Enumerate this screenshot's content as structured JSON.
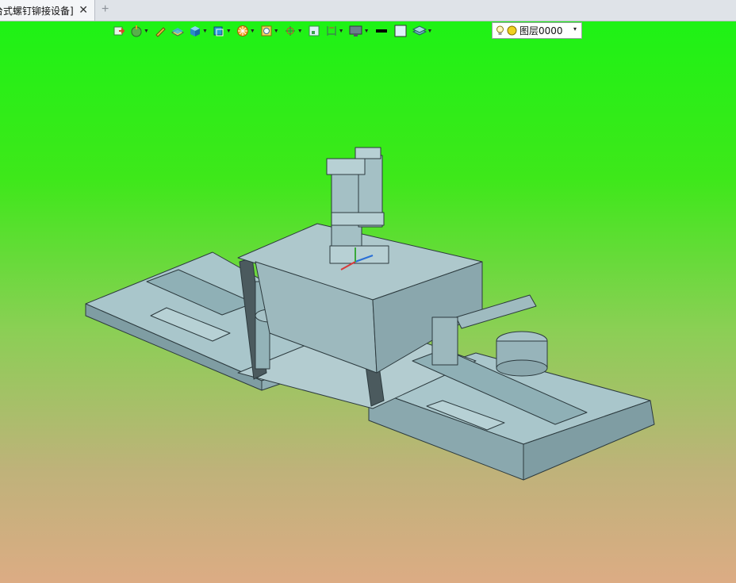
{
  "tab": {
    "title": "台式螺钉铆接设备]",
    "close": "✕",
    "add": "+"
  },
  "toolbar": {
    "buttons": [
      {
        "name": "import-icon"
      },
      {
        "name": "globe-icon"
      },
      {
        "name": "pencil-icon"
      },
      {
        "name": "surface-icon"
      },
      {
        "name": "solid-box-icon"
      },
      {
        "name": "view-cube-icon"
      },
      {
        "name": "render-icon"
      },
      {
        "name": "zoom-icon"
      },
      {
        "name": "axis-icon"
      },
      {
        "name": "frame-icon"
      },
      {
        "name": "dimension-icon"
      },
      {
        "name": "display-icon"
      },
      {
        "name": "line-color-icon"
      },
      {
        "name": "fill-color-icon"
      },
      {
        "name": "layer-stack-icon"
      }
    ],
    "layer": {
      "value": "图层0000",
      "arrow": "▾"
    }
  },
  "colors": {
    "bg_top": "#1ef215",
    "bg_bottom": "#dcac84",
    "model_face": "#9fc0c6",
    "model_edge": "#2c3a3e"
  }
}
